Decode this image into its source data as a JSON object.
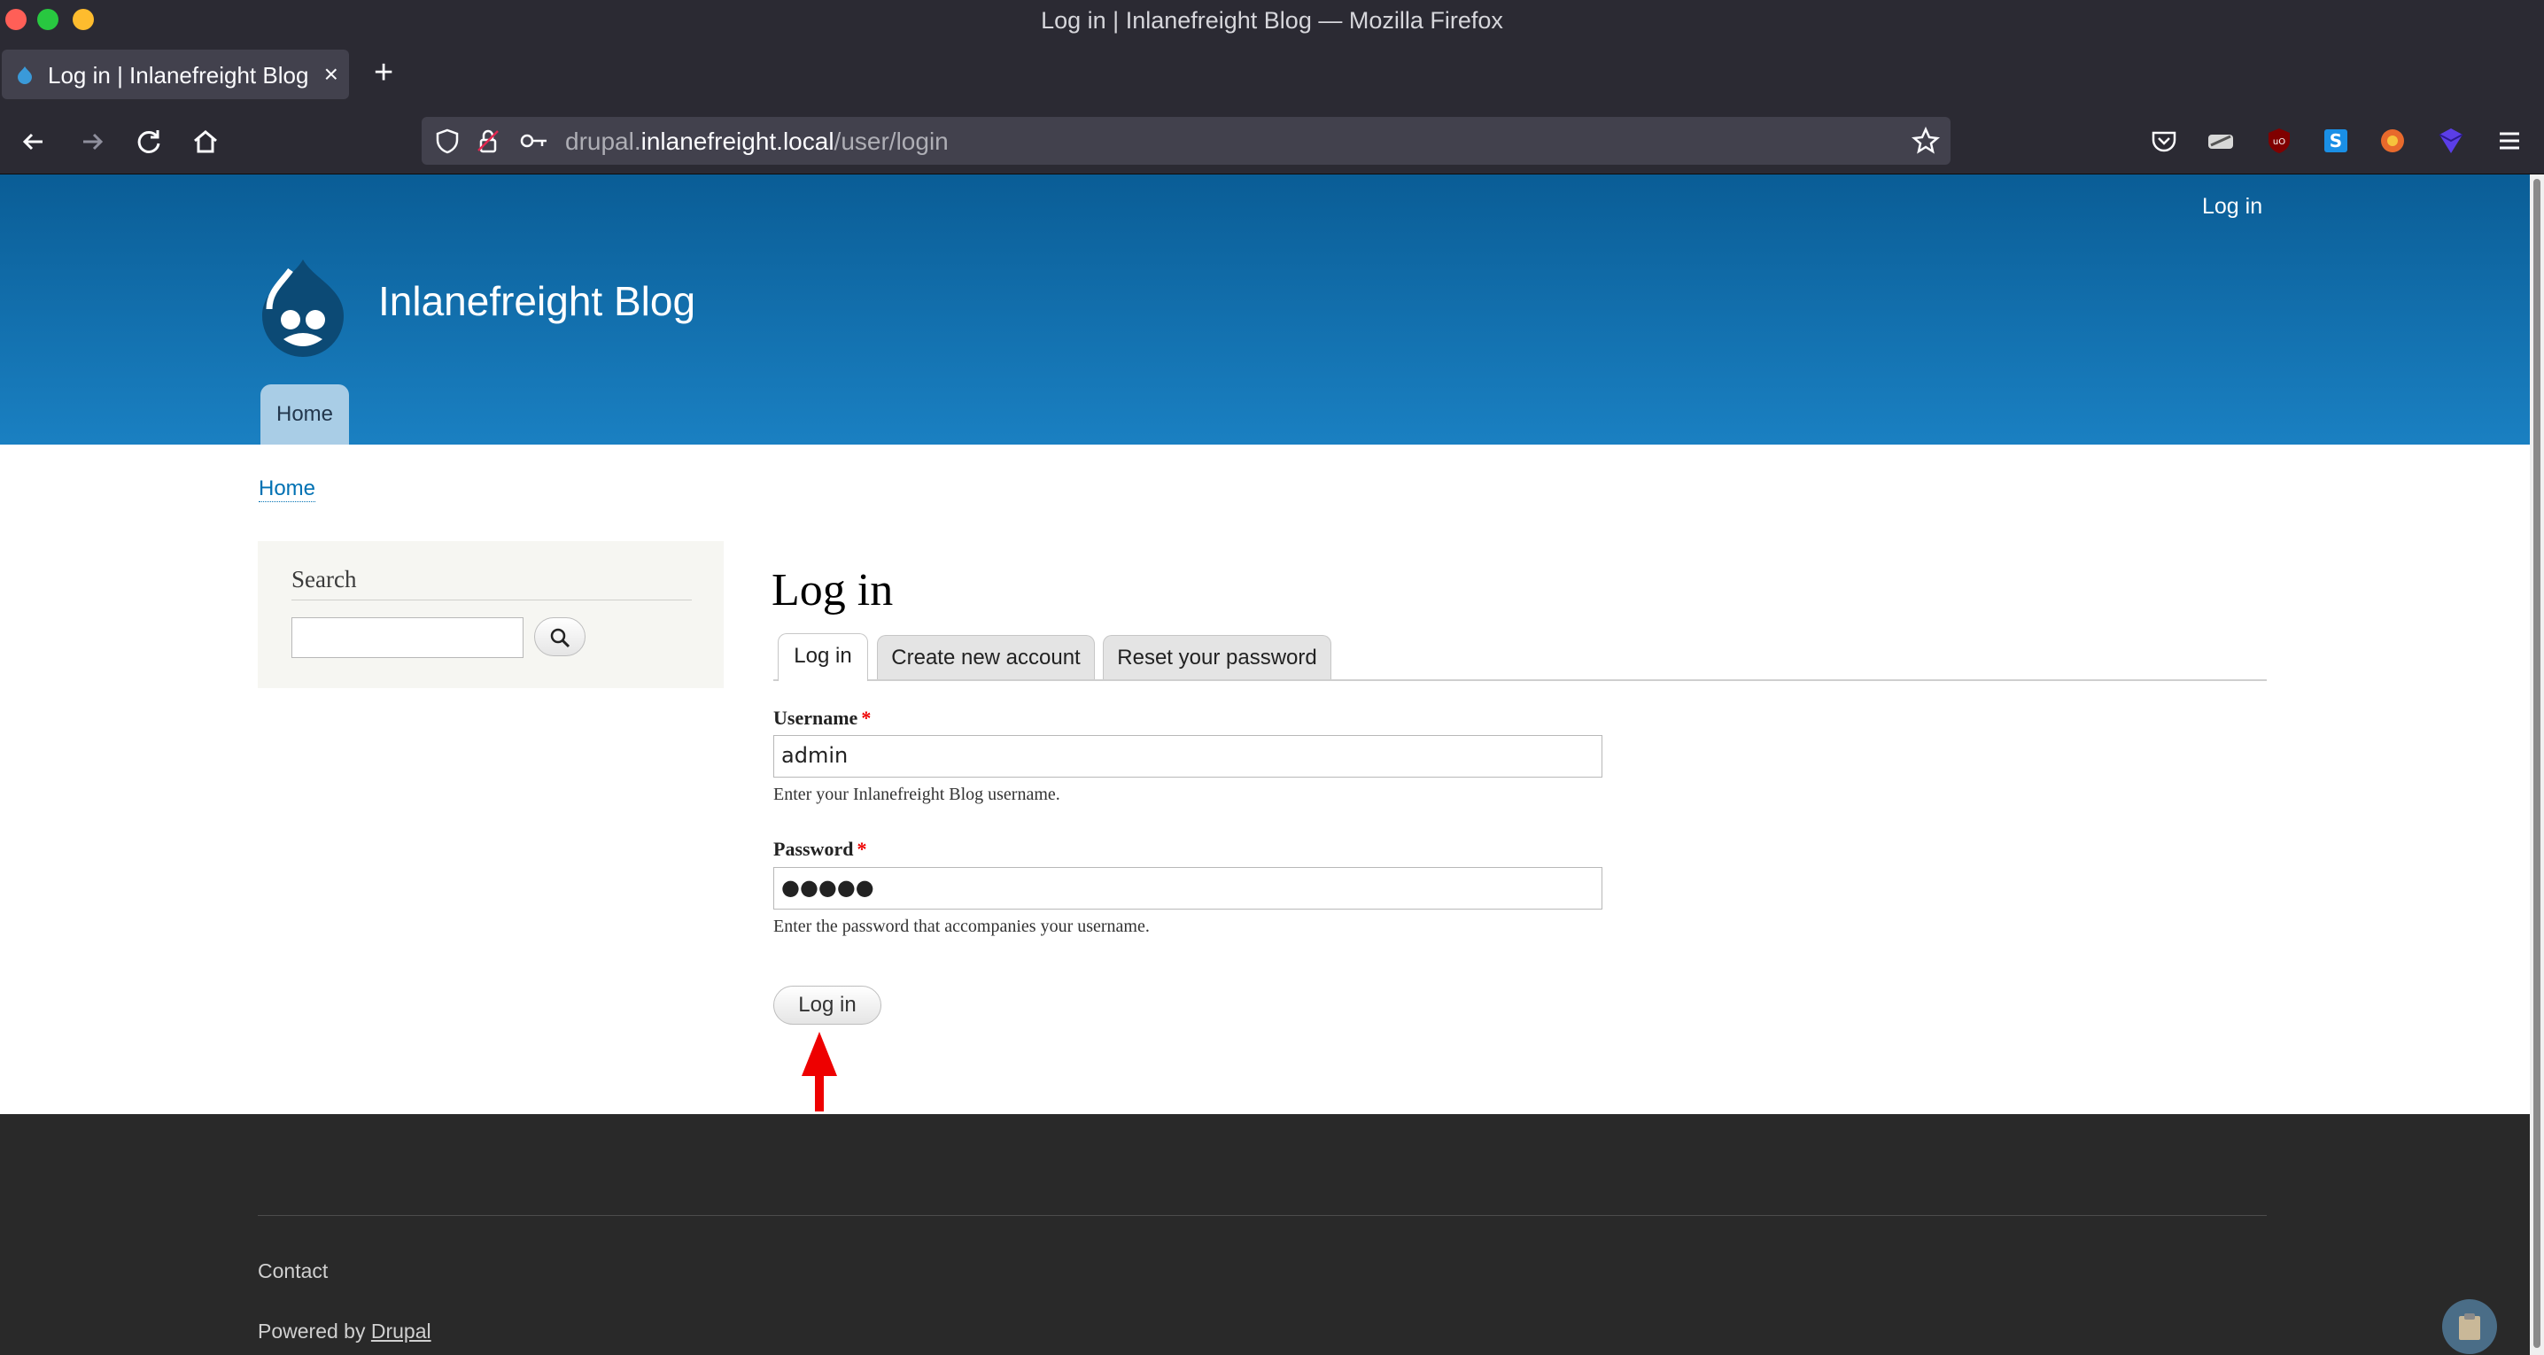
{
  "window": {
    "title": "Log in | Inlanefreight Blog — Mozilla Firefox"
  },
  "browser": {
    "tab_title": "Log in | Inlanefreight Blog",
    "tab_close": "×",
    "new_tab": "+",
    "url": {
      "prefix": "drupal.",
      "domain": "inlanefreight.local",
      "path": "/user/login"
    }
  },
  "header": {
    "top_login": "Log in",
    "site_name": "Inlanefreight Blog",
    "nav_home": "Home"
  },
  "breadcrumb": "Home",
  "sidebar": {
    "title": "Search",
    "input_value": ""
  },
  "main": {
    "title": "Log in",
    "tabs": [
      {
        "label": "Log in",
        "active": true
      },
      {
        "label": "Create new account",
        "active": false
      },
      {
        "label": "Reset your password",
        "active": false
      }
    ],
    "username": {
      "label": "Username",
      "required": "*",
      "value": "admin",
      "help": "Enter your Inlanefreight Blog username."
    },
    "password": {
      "label": "Password",
      "required": "*",
      "value": "●●●●●",
      "help": "Enter the password that accompanies your username."
    },
    "submit": "Log in"
  },
  "footer": {
    "contact": "Contact",
    "powered_prefix": "Powered by",
    "powered_link": "Drupal"
  },
  "colors": {
    "header_top": "#0a5d96",
    "header_bottom": "#1a80c2",
    "footer": "#292929",
    "annotation_arrow": "#ee0000"
  }
}
